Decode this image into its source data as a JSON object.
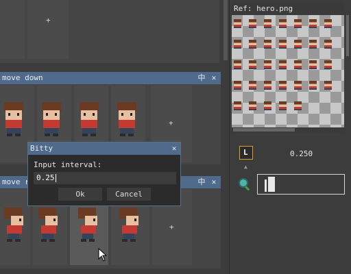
{
  "top_panel": {
    "plus": "+"
  },
  "panel_down": {
    "title": "move down",
    "icon_dock": "dock-icon",
    "icon_close": "close-icon",
    "plus": "+"
  },
  "panel_right": {
    "title": "move r",
    "icon_dock": "dock-icon",
    "icon_close": "close-icon",
    "plus": "+"
  },
  "dialog": {
    "title": "Bitty",
    "label": "Input interval:",
    "value": "0.25",
    "ok": "Ok",
    "cancel": "Cancel"
  },
  "ref": {
    "title": "Ref: hero.png"
  },
  "props": {
    "loop_icon": "L",
    "interval": "0.250",
    "zoom_icon": "magnifier-icon"
  },
  "colors": {
    "accent": "#4f6a8a",
    "bg": "#3c3c3c",
    "hair": "#6a3a22",
    "shirt": "#c23a32",
    "skin": "#e8c0a0"
  }
}
